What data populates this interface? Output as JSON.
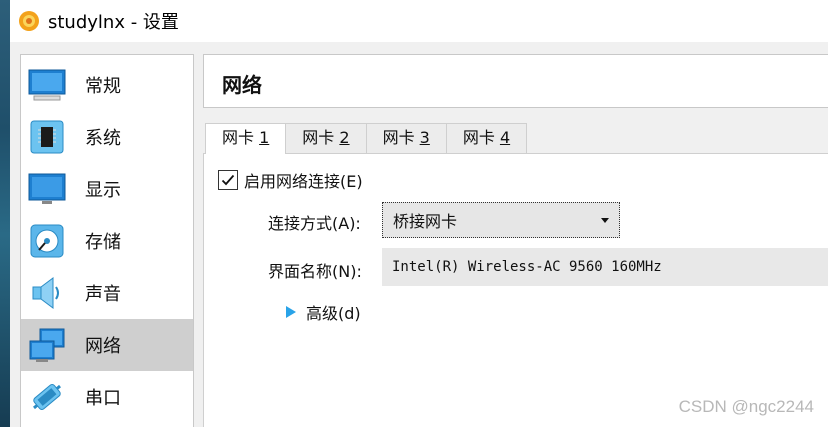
{
  "window": {
    "title": "studylnx - 设置"
  },
  "sidebar": {
    "items": [
      {
        "label": "常规",
        "icon": "monitor-general-icon"
      },
      {
        "label": "系统",
        "icon": "chip-icon"
      },
      {
        "label": "显示",
        "icon": "display-icon"
      },
      {
        "label": "存储",
        "icon": "disk-icon"
      },
      {
        "label": "声音",
        "icon": "speaker-icon"
      },
      {
        "label": "网络",
        "icon": "network-icon",
        "selected": true
      },
      {
        "label": "串口",
        "icon": "serial-port-icon"
      }
    ]
  },
  "main": {
    "title": "网络",
    "tabs": [
      {
        "label": "网卡 1",
        "text": "网卡 ",
        "mnemonic": "1",
        "active": true
      },
      {
        "label": "网卡 2",
        "text": "网卡 ",
        "mnemonic": "2"
      },
      {
        "label": "网卡 3",
        "text": "网卡 ",
        "mnemonic": "3"
      },
      {
        "label": "网卡 4",
        "text": "网卡 ",
        "mnemonic": "4"
      }
    ],
    "enable_checkbox": {
      "label": "启用网络连接(E)",
      "checked": true
    },
    "attached_to": {
      "label": "连接方式(A):",
      "value": "桥接网卡"
    },
    "interface_name": {
      "label": "界面名称(N):",
      "value": "Intel(R) Wireless-AC 9560 160MHz"
    },
    "advanced": {
      "label": "高级(d)"
    }
  },
  "watermark": "CSDN @ngc2244",
  "colors": {
    "accent": "#29a3e8",
    "selected_bg": "#cfcfcf"
  }
}
